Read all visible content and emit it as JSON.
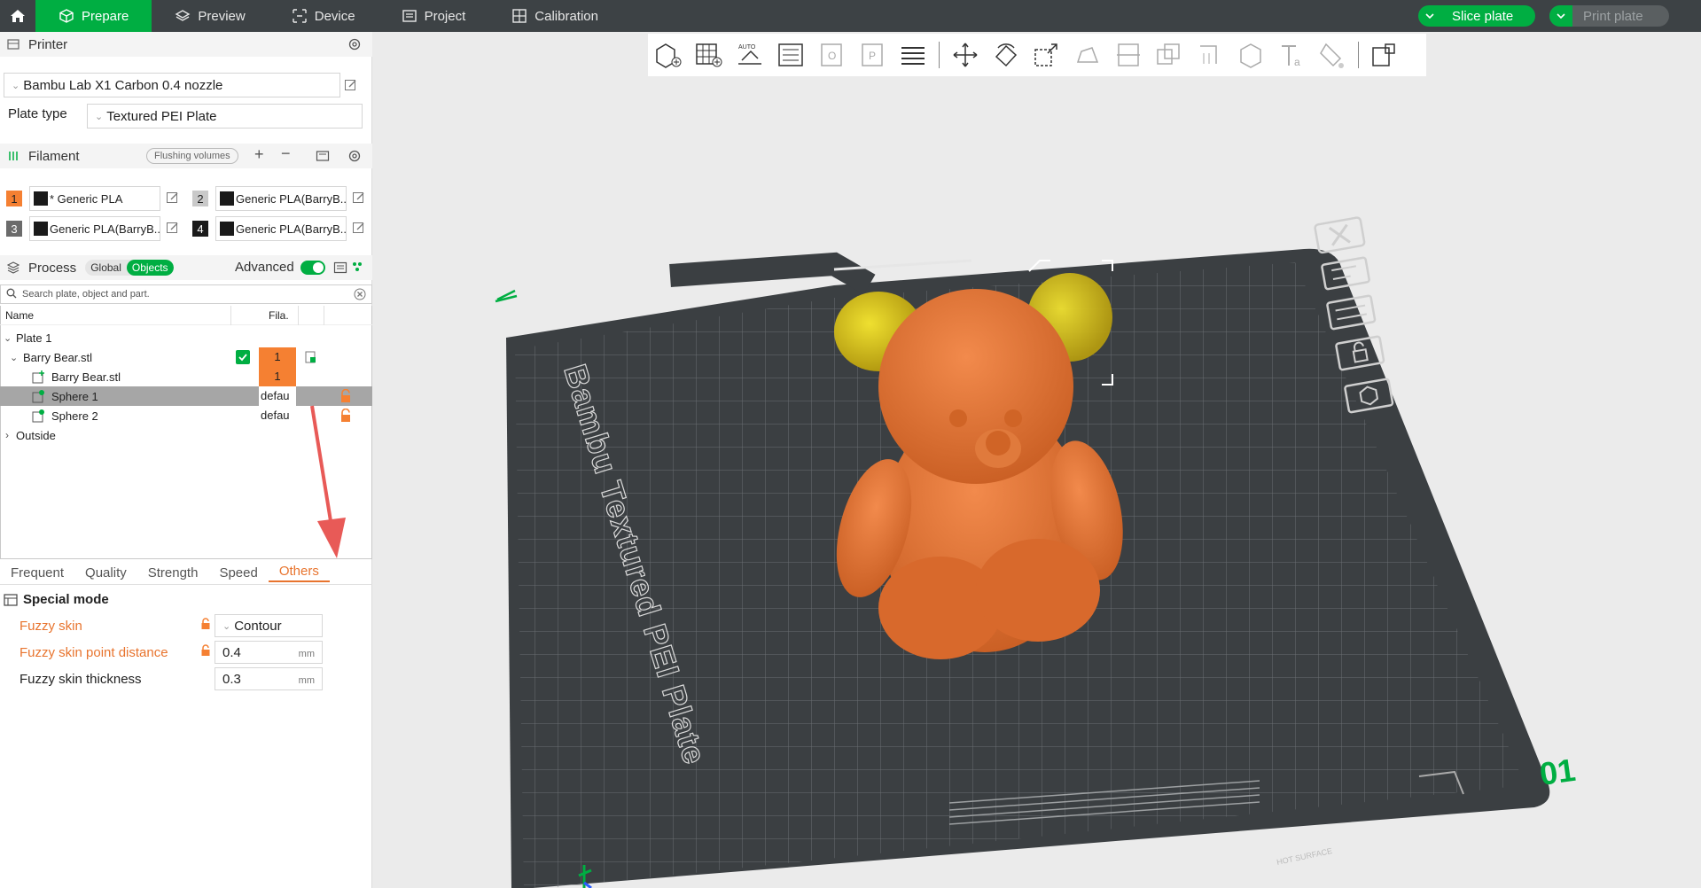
{
  "topbar": {
    "tabs": [
      {
        "label": "Prepare",
        "active": true
      },
      {
        "label": "Preview"
      },
      {
        "label": "Device"
      },
      {
        "label": "Project"
      },
      {
        "label": "Calibration"
      }
    ],
    "slice_label": "Slice plate",
    "print_label": "Print plate"
  },
  "printer": {
    "title": "Printer",
    "name": "Bambu Lab X1 Carbon 0.4 nozzle",
    "plate_type_label": "Plate type",
    "plate_type": "Textured PEI Plate"
  },
  "filament": {
    "title": "Filament",
    "flushing_label": "Flushing volumes",
    "items": [
      {
        "num": "1",
        "name": "* Generic PLA",
        "color": "#f58032"
      },
      {
        "num": "2",
        "name": "Generic PLA(BarryB...",
        "color": "#c9c9c9"
      },
      {
        "num": "3",
        "name": "Generic PLA(BarryB...",
        "color": "#6b6b6b"
      },
      {
        "num": "4",
        "name": "Generic PLA(BarryB...",
        "color": "#1a1a1a"
      }
    ]
  },
  "process": {
    "title": "Process",
    "global_label": "Global",
    "objects_label": "Objects",
    "advanced_label": "Advanced",
    "search_placeholder": "Search plate, object and part.",
    "col_name": "Name",
    "col_fila": "Fila.",
    "tree": {
      "plate": "Plate 1",
      "object": "Barry Bear.stl",
      "object_fila": "1",
      "part": "Barry Bear.stl",
      "part_fila": "1",
      "sphere1": "Sphere 1",
      "sphere1_fila": "defau",
      "sphere2": "Sphere 2",
      "sphere2_fila": "defau",
      "outside": "Outside"
    }
  },
  "settings_tabs": [
    "Frequent",
    "Quality",
    "Strength",
    "Speed",
    "Others"
  ],
  "special_mode": {
    "title": "Special mode",
    "fuzzy_skin_label": "Fuzzy skin",
    "fuzzy_skin_value": "Contour",
    "point_distance_label": "Fuzzy skin point distance",
    "point_distance_value": "0.4",
    "thickness_label": "Fuzzy skin thickness",
    "thickness_value": "0.3",
    "unit": "mm"
  },
  "plate": {
    "name": "Bambu Textured PEI Plate",
    "number": "01",
    "hot_surface": "HOT SURFACE"
  },
  "colors": {
    "accent": "#00ae42",
    "orange": "#e8742e",
    "bear": "#e8773a",
    "ears": "#d8c21a"
  }
}
